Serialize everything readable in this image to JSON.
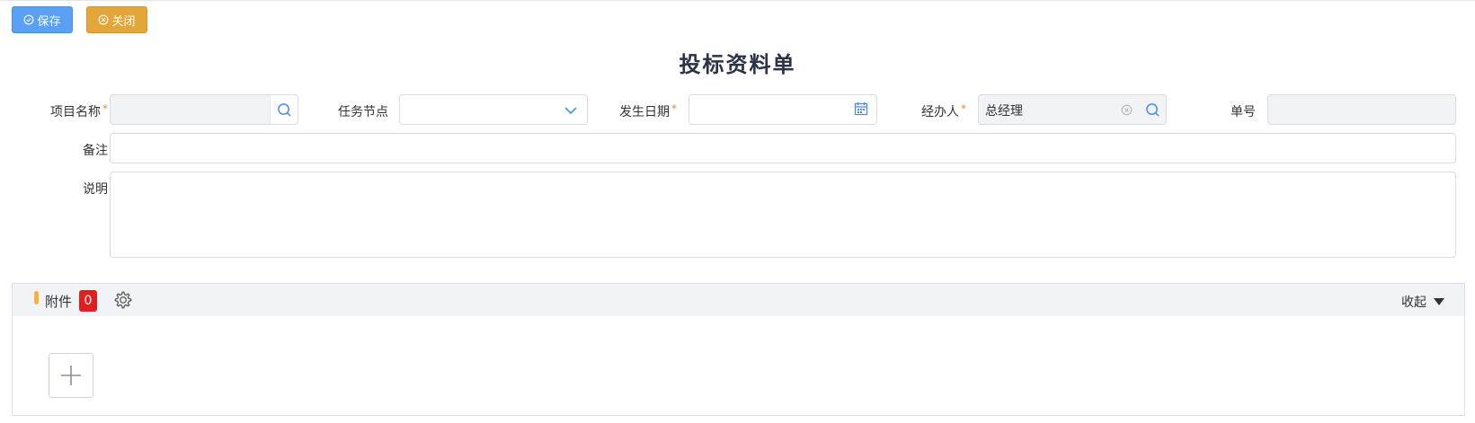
{
  "toolbar": {
    "save_label": "保存",
    "close_label": "关闭"
  },
  "form": {
    "title": "投标资料单",
    "project_name": {
      "label": "项目名称",
      "required": "*",
      "value": ""
    },
    "task_node": {
      "label": "任务节点",
      "value": ""
    },
    "occur_date": {
      "label": "发生日期",
      "required": "*",
      "value": ""
    },
    "handler": {
      "label": "经办人",
      "required": "*",
      "value": "总经理"
    },
    "doc_no": {
      "label": "单号",
      "value": ""
    },
    "remark": {
      "label": "备注",
      "value": ""
    },
    "description": {
      "label": "说明",
      "value": ""
    }
  },
  "attachments": {
    "title": "附件",
    "count": "0",
    "collapse_label": "收起"
  },
  "colors": {
    "save": "#5aa0f7",
    "close": "#e3a63a",
    "badge": "#e02020",
    "accent_bar": "#f5b041",
    "icon_blue": "#4a8ff0"
  }
}
